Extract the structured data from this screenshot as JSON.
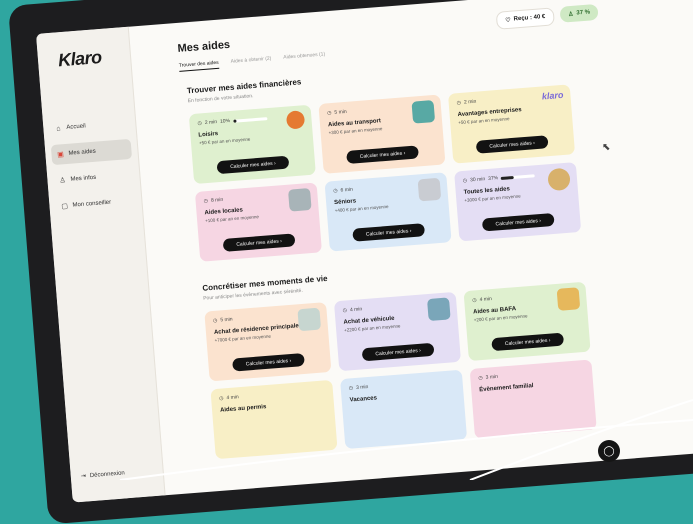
{
  "app": {
    "logo": "Klaro"
  },
  "sidebar": {
    "items": [
      {
        "label": "Accueil",
        "icon": "home-icon"
      },
      {
        "label": "Mes aides",
        "icon": "aid-icon"
      },
      {
        "label": "Mes infos",
        "icon": "user-icon"
      },
      {
        "label": "Mon conseiller",
        "icon": "advisor-icon"
      }
    ],
    "disconnect_label": "Déconnexion"
  },
  "header": {
    "title": "Mes aides",
    "tabs": [
      "Trouver des aides",
      "Aides à obtenir (2)",
      "Aides obtenues (1)"
    ],
    "received_label": "Reçu : 40 €",
    "percent_label": "37 %"
  },
  "sections": {
    "financial": {
      "title": "Trouver mes aides financières",
      "subtitle": "En fonction de votre situation."
    },
    "life": {
      "title": "Concrétiser mes moments de vie",
      "subtitle": "Pour anticiper les évènements avec sérénité."
    }
  },
  "cards_financial": [
    {
      "time": "2 min",
      "progress_label": "10%",
      "progress": 0.1,
      "title": "Loisirs",
      "desc": "+50 € par an en moyenne",
      "button": "Calculer mes aides ›"
    },
    {
      "time": "5 min",
      "title": "Aides au transport",
      "desc": "+300 € par an en moyenne",
      "button": "Calculer mes aides ›"
    },
    {
      "time": "2 min",
      "title": "Avantages entreprises",
      "desc": "+50 € par an en moyenne",
      "button": "Calculer mes aides ›",
      "brand": "klaro"
    },
    {
      "time": "8 min",
      "title": "Aides locales",
      "desc": "+100 € par an en moyenne",
      "button": "Calculer mes aides ›"
    },
    {
      "time": "6 min",
      "title": "Séniors",
      "desc": "+400 € par an en moyenne",
      "button": "Calculer mes aides ›"
    },
    {
      "time": "30 min",
      "progress_label": "37%",
      "progress": 0.37,
      "title": "Toutes les aides",
      "desc": "+3000 € par an en moyenne",
      "button": "Calculer mes aides ›"
    }
  ],
  "cards_life": [
    {
      "time": "5 min",
      "title": "Achat de résidence principale",
      "desc": "+7000 € par an en moyenne",
      "button": "Calculer mes aides ›"
    },
    {
      "time": "4 min",
      "title": "Achat de véhicule",
      "desc": "+2200 € par an en moyenne",
      "button": "Calculer mes aides ›"
    },
    {
      "time": "4 min",
      "title": "Aides au BAFA",
      "desc": "+200 € par an en moyenne",
      "button": "Calculer mes aides ›"
    },
    {
      "time": "4 min",
      "title": "Aides au permis",
      "desc": "",
      "button": ""
    },
    {
      "time": "3 min",
      "title": "Vacances",
      "desc": "",
      "button": ""
    },
    {
      "time": "3 min",
      "title": "Évènement familial",
      "desc": "",
      "button": ""
    }
  ],
  "colors": {
    "accent": "#121212",
    "percent_pill": "#cfe9c4",
    "background": "#2fa6a0"
  }
}
